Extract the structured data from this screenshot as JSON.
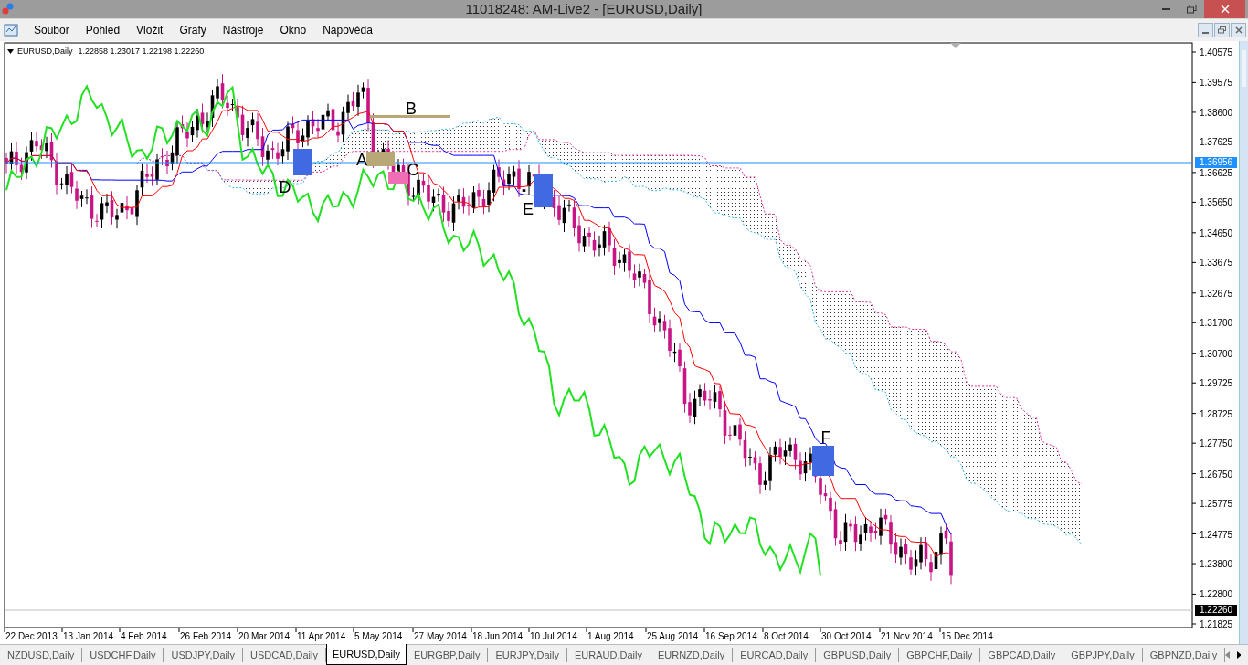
{
  "window": {
    "title": "11018248: AM-Live2 - [EURUSD,Daily]"
  },
  "menu": [
    "Soubor",
    "Pohled",
    "Vložit",
    "Grafy",
    "Nástroje",
    "Okno",
    "Nápověda"
  ],
  "chart": {
    "symbol": "EURUSD,Daily",
    "ohlc": "1.22858 1.23017 1.22198 1.22260",
    "price_labels": [
      "1.40575",
      "1.39575",
      "1.38600",
      "1.37625",
      "1.36625",
      "1.35650",
      "1.34650",
      "1.33675",
      "1.32675",
      "1.31700",
      "1.30700",
      "1.29725",
      "1.28725",
      "1.27750",
      "1.26750",
      "1.25775",
      "1.24775",
      "1.23800",
      "1.22800",
      "1.21825"
    ],
    "line_price": "1.36956",
    "current_price": "1.22260",
    "date_labels": [
      "22 Dec 2013",
      "13 Jan 2014",
      "4 Feb 2014",
      "26 Feb 2014",
      "20 Mar 2014",
      "11 Apr 2014",
      "5 May 2014",
      "27 May 2014",
      "18 Jun 2014",
      "10 Jul 2014",
      "1 Aug 2014",
      "25 Aug 2014",
      "16 Sep 2014",
      "8 Oct 2014",
      "30 Oct 2014",
      "21 Nov 2014",
      "15 Dec 2014"
    ],
    "markers": [
      {
        "label": "B",
        "color": "#b8a878"
      },
      {
        "label": "A",
        "color": "#b8a878"
      },
      {
        "label": "C",
        "color": "#f06eb4"
      },
      {
        "label": "D",
        "color": "#4169e1"
      },
      {
        "label": "E",
        "color": "#4169e1"
      },
      {
        "label": "F",
        "color": "#4169e1"
      }
    ]
  },
  "tabs": [
    {
      "label": "NZDUSD,Daily",
      "selected": false
    },
    {
      "label": "USDCHF,Daily",
      "selected": false
    },
    {
      "label": "USDJPY,Daily",
      "selected": false
    },
    {
      "label": "USDCAD,Daily",
      "selected": false
    },
    {
      "label": "EURUSD,Daily",
      "selected": true
    },
    {
      "label": "EURGBP,Daily",
      "selected": false
    },
    {
      "label": "EURJPY,Daily",
      "selected": false
    },
    {
      "label": "EURAUD,Daily",
      "selected": false
    },
    {
      "label": "EURNZD,Daily",
      "selected": false
    },
    {
      "label": "EURCAD,Daily",
      "selected": false
    },
    {
      "label": "GBPUSD,Daily",
      "selected": false
    },
    {
      "label": "GBPCHF,Daily",
      "selected": false
    },
    {
      "label": "GBPCAD,Daily",
      "selected": false
    },
    {
      "label": "GBPJPY,Daily",
      "selected": false
    },
    {
      "label": "GBPNZD,Daily",
      "selected": false
    }
  ]
}
